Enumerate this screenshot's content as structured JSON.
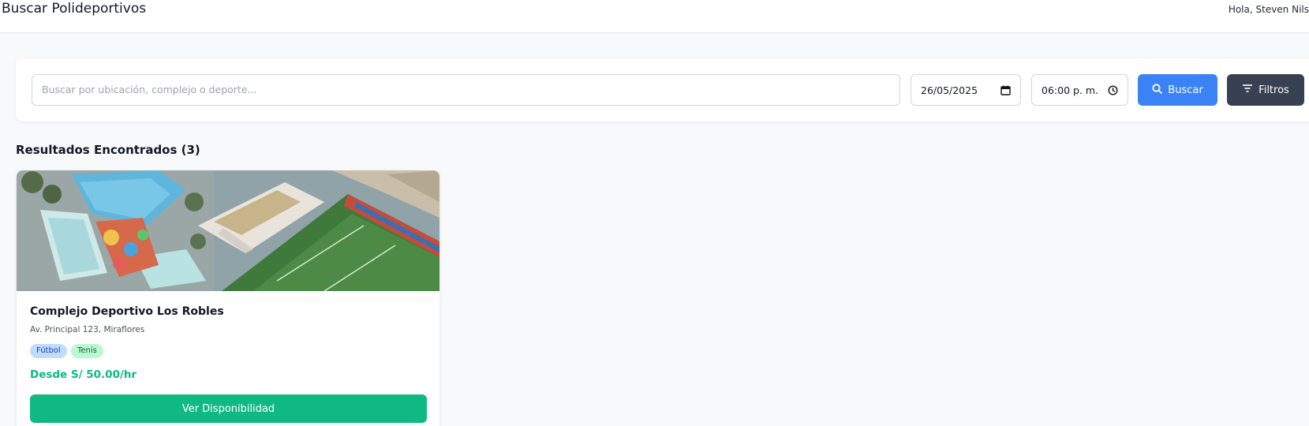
{
  "header": {
    "title": "Buscar Polideportivos",
    "greeting": "Hola, Steven Nils"
  },
  "search": {
    "placeholder": "Buscar por ubicación, complejo o deporte...",
    "date_value": "26/05/2025",
    "time_value": "06:00 p. m.",
    "search_button": "Buscar",
    "filters_button": "Filtros"
  },
  "results": {
    "title": "Resultados Encontrados (3)",
    "items": [
      {
        "name": "Complejo Deportivo Los Robles",
        "address": "Av. Principal 123, Miraflores",
        "tags": [
          "Fútbol",
          "Tenis"
        ],
        "price": "Desde S/ 50.00/hr",
        "action": "Ver Disponibilidad"
      }
    ]
  },
  "icons": {
    "date": "calendar-icon",
    "time": "clock-icon",
    "search": "search-icon",
    "filters": "filter-icon"
  },
  "colors": {
    "primary": "#3b82f6",
    "dark": "#374151",
    "success": "#10b981",
    "tag_blue_bg": "#bfdbfe",
    "tag_green_bg": "#bbf7d0"
  }
}
